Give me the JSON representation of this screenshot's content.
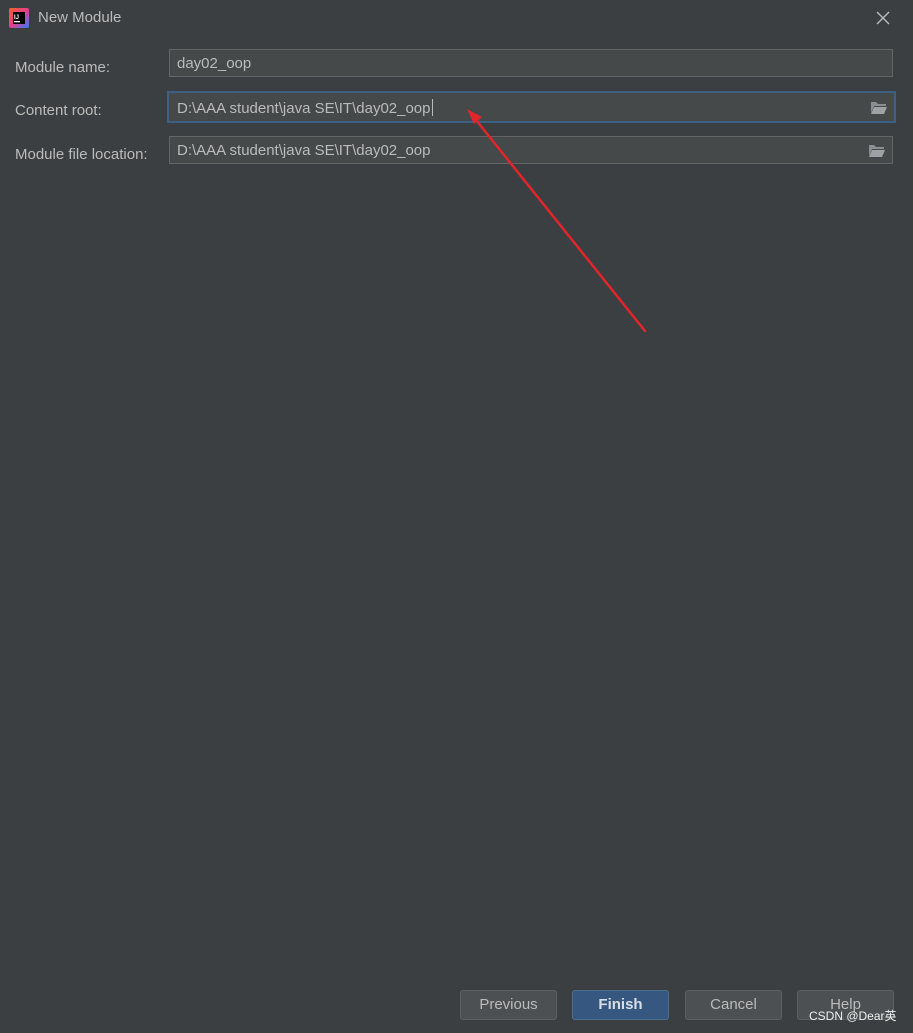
{
  "window": {
    "title": "New Module",
    "app_icon": "intellij-idea-icon",
    "close_icon": "close-icon"
  },
  "form": {
    "module_name": {
      "label": "Module name:",
      "value": "day02_oop"
    },
    "content_root": {
      "label": "Content root:",
      "value": "D:\\AAA student\\java SE\\IT\\day02_oop",
      "browse_icon": "folder-open-icon"
    },
    "module_file_location": {
      "label": "Module file location:",
      "value": "D:\\AAA student\\java SE\\IT\\day02_oop",
      "browse_icon": "folder-open-icon"
    }
  },
  "annotation": {
    "arrow_color": "#e0262a"
  },
  "buttons": {
    "previous": "Previous",
    "finish": "Finish",
    "cancel": "Cancel",
    "help": "Help"
  },
  "watermark": "CSDN @Dear英",
  "colors": {
    "background": "#3c3f41",
    "field_background": "#45494a",
    "focus_border": "#3d6185",
    "default_button": "#365880",
    "text": "#bbbbbb"
  }
}
